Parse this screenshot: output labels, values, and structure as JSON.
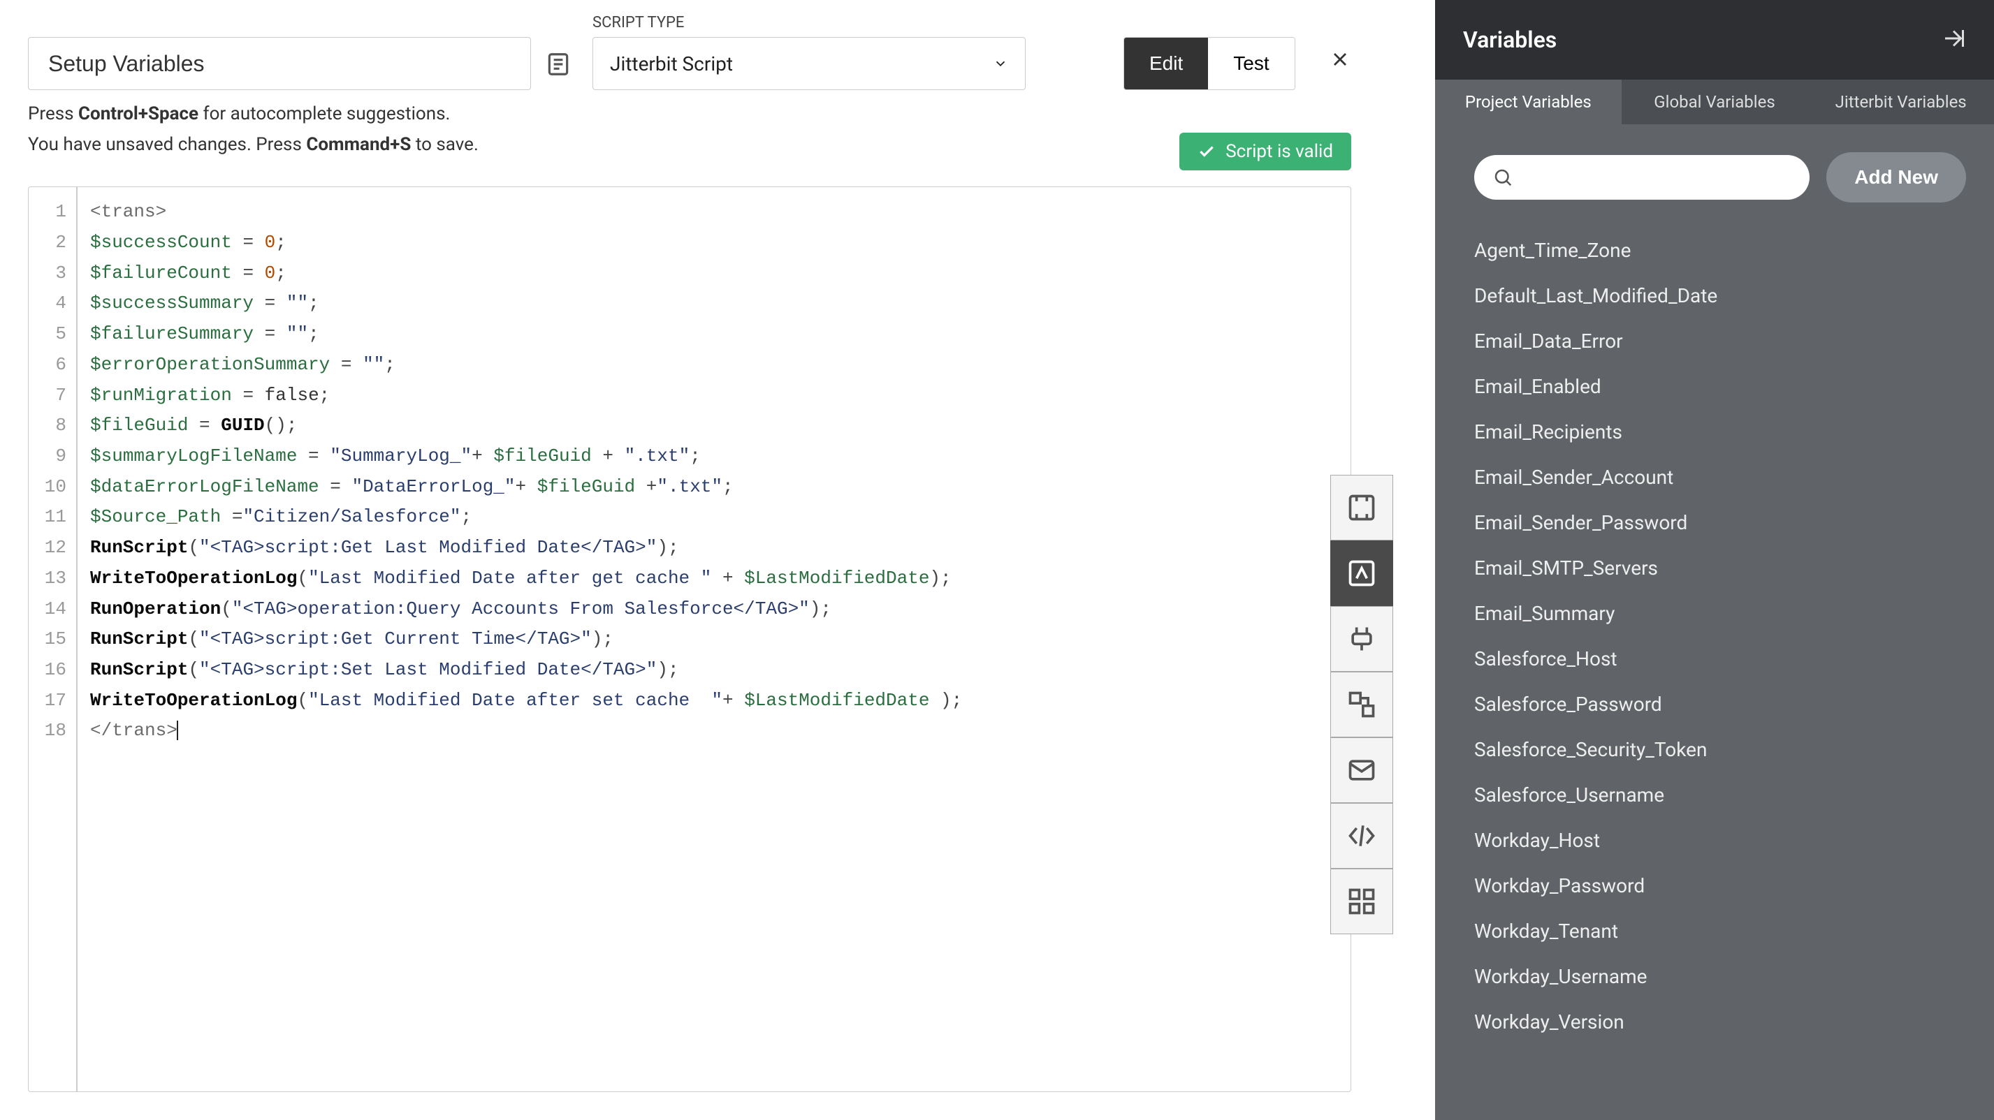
{
  "header": {
    "title_value": "Setup Variables",
    "script_type_label": "SCRIPT TYPE",
    "script_type_value": "Jitterbit Script",
    "edit_label": "Edit",
    "test_label": "Test"
  },
  "hints": {
    "line1_pre": "Press ",
    "line1_kbd": "Control+Space",
    "line1_post": " for autocomplete suggestions.",
    "line2_pre": "You have unsaved changes. Press ",
    "line2_kbd": "Command+S",
    "line2_post": " to save."
  },
  "valid_badge": "Script is valid",
  "code_lines": [
    [
      {
        "t": "tag",
        "v": "<trans>"
      }
    ],
    [
      {
        "t": "var",
        "v": "$successCount"
      },
      {
        "t": "op",
        "v": " = "
      },
      {
        "t": "num",
        "v": "0"
      },
      {
        "t": "op",
        "v": ";"
      }
    ],
    [
      {
        "t": "var",
        "v": "$failureCount"
      },
      {
        "t": "op",
        "v": " = "
      },
      {
        "t": "num",
        "v": "0"
      },
      {
        "t": "op",
        "v": ";"
      }
    ],
    [
      {
        "t": "var",
        "v": "$successSummary"
      },
      {
        "t": "op",
        "v": " = "
      },
      {
        "t": "str",
        "v": "\"\""
      },
      {
        "t": "op",
        "v": ";"
      }
    ],
    [
      {
        "t": "var",
        "v": "$failureSummary"
      },
      {
        "t": "op",
        "v": " = "
      },
      {
        "t": "str",
        "v": "\"\""
      },
      {
        "t": "op",
        "v": ";"
      }
    ],
    [
      {
        "t": "var",
        "v": "$errorOperationSummary"
      },
      {
        "t": "op",
        "v": " = "
      },
      {
        "t": "str",
        "v": "\"\""
      },
      {
        "t": "op",
        "v": ";"
      }
    ],
    [
      {
        "t": "var",
        "v": "$runMigration"
      },
      {
        "t": "op",
        "v": " = "
      },
      {
        "t": "kw",
        "v": "false"
      },
      {
        "t": "op",
        "v": ";"
      }
    ],
    [
      {
        "t": "var",
        "v": "$fileGuid"
      },
      {
        "t": "op",
        "v": " = "
      },
      {
        "t": "fn",
        "v": "GUID"
      },
      {
        "t": "op",
        "v": "();"
      }
    ],
    [
      {
        "t": "var",
        "v": "$summaryLogFileName"
      },
      {
        "t": "op",
        "v": " = "
      },
      {
        "t": "str",
        "v": "\"SummaryLog_\""
      },
      {
        "t": "op",
        "v": "+ "
      },
      {
        "t": "var",
        "v": "$fileGuid"
      },
      {
        "t": "op",
        "v": " + "
      },
      {
        "t": "str",
        "v": "\".txt\""
      },
      {
        "t": "op",
        "v": ";"
      }
    ],
    [
      {
        "t": "var",
        "v": "$dataErrorLogFileName"
      },
      {
        "t": "op",
        "v": " = "
      },
      {
        "t": "str",
        "v": "\"DataErrorLog_\""
      },
      {
        "t": "op",
        "v": "+ "
      },
      {
        "t": "var",
        "v": "$fileGuid"
      },
      {
        "t": "op",
        "v": " +"
      },
      {
        "t": "str",
        "v": "\".txt\""
      },
      {
        "t": "op",
        "v": ";"
      }
    ],
    [
      {
        "t": "var",
        "v": "$Source_Path"
      },
      {
        "t": "op",
        "v": " ="
      },
      {
        "t": "str",
        "v": "\"Citizen/Salesforce\""
      },
      {
        "t": "op",
        "v": ";"
      }
    ],
    [
      {
        "t": "fn",
        "v": "RunScript"
      },
      {
        "t": "op",
        "v": "("
      },
      {
        "t": "str",
        "v": "\"<TAG>script:Get Last Modified Date</TAG>\""
      },
      {
        "t": "op",
        "v": ");"
      }
    ],
    [
      {
        "t": "fn",
        "v": "WriteToOperationLog"
      },
      {
        "t": "op",
        "v": "("
      },
      {
        "t": "str",
        "v": "\"Last Modified Date after get cache \""
      },
      {
        "t": "op",
        "v": " + "
      },
      {
        "t": "var",
        "v": "$LastModifiedDate"
      },
      {
        "t": "op",
        "v": ");"
      }
    ],
    [
      {
        "t": "fn",
        "v": "RunOperation"
      },
      {
        "t": "op",
        "v": "("
      },
      {
        "t": "str",
        "v": "\"<TAG>operation:Query Accounts From Salesforce</TAG>\""
      },
      {
        "t": "op",
        "v": ");"
      }
    ],
    [
      {
        "t": "fn",
        "v": "RunScript"
      },
      {
        "t": "op",
        "v": "("
      },
      {
        "t": "str",
        "v": "\"<TAG>script:Get Current Time</TAG>\""
      },
      {
        "t": "op",
        "v": ");"
      }
    ],
    [
      {
        "t": "fn",
        "v": "RunScript"
      },
      {
        "t": "op",
        "v": "("
      },
      {
        "t": "str",
        "v": "\"<TAG>script:Set Last Modified Date</TAG>\""
      },
      {
        "t": "op",
        "v": ");"
      }
    ],
    [
      {
        "t": "fn",
        "v": "WriteToOperationLog"
      },
      {
        "t": "op",
        "v": "("
      },
      {
        "t": "str",
        "v": "\"Last Modified Date after set cache  \""
      },
      {
        "t": "op",
        "v": "+ "
      },
      {
        "t": "var",
        "v": "$LastModifiedDate"
      },
      {
        "t": "op",
        "v": " );"
      }
    ],
    [
      {
        "t": "tag",
        "v": "</trans>"
      }
    ]
  ],
  "rail_icons": [
    "fullscreen-icon",
    "variable-icon",
    "plugin-icon",
    "operations-icon",
    "email-icon",
    "script-icon",
    "grid-icon"
  ],
  "sidebar": {
    "title": "Variables",
    "tabs": [
      "Project Variables",
      "Global Variables",
      "Jitterbit Variables"
    ],
    "active_tab": 0,
    "add_new_label": "Add New",
    "search_placeholder": "",
    "variables": [
      "Agent_Time_Zone",
      "Default_Last_Modified_Date",
      "Email_Data_Error",
      "Email_Enabled",
      "Email_Recipients",
      "Email_Sender_Account",
      "Email_Sender_Password",
      "Email_SMTP_Servers",
      "Email_Summary",
      "Salesforce_Host",
      "Salesforce_Password",
      "Salesforce_Security_Token",
      "Salesforce_Username",
      "Workday_Host",
      "Workday_Password",
      "Workday_Tenant",
      "Workday_Username",
      "Workday_Version"
    ]
  }
}
